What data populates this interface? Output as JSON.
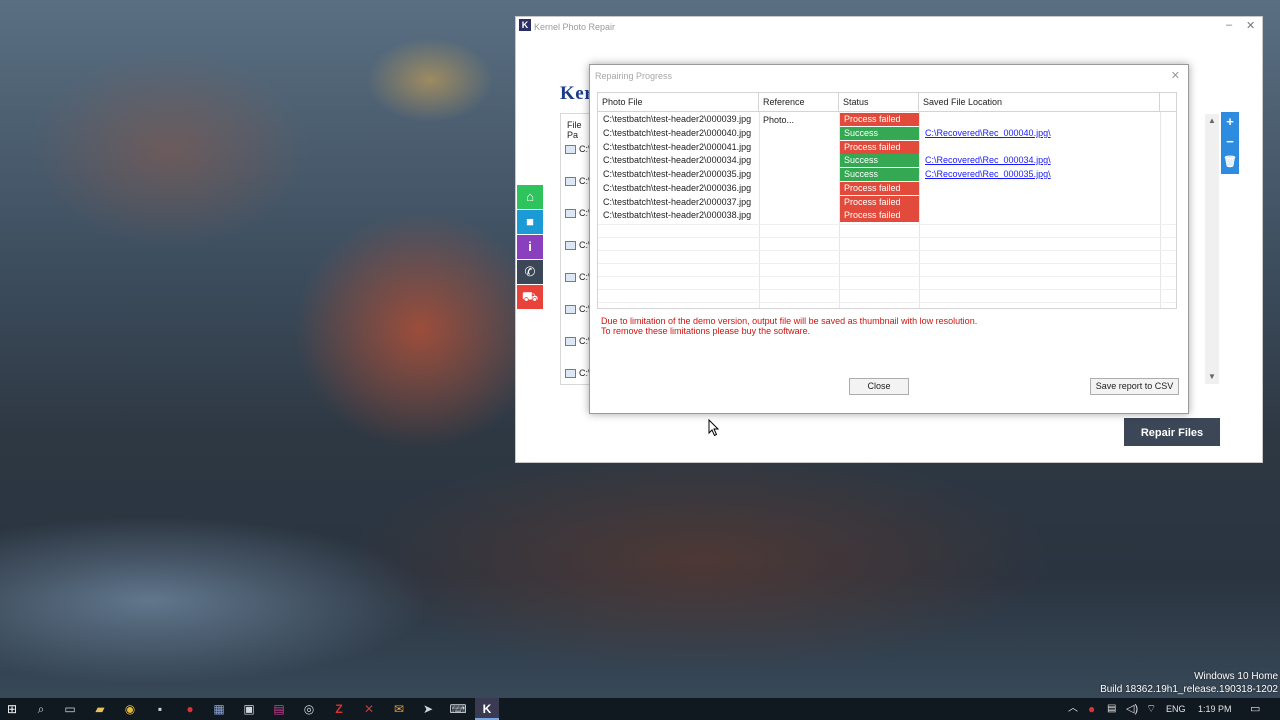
{
  "desktop": {
    "watermark_line1": "Windows 10 Home",
    "watermark_line2": "Build 18362.19h1_release.190318-1202"
  },
  "main_window": {
    "title": "Kernel Photo Repair",
    "app_icon_letter": "K",
    "minimize_glyph": "–",
    "close_glyph": "✕",
    "logo_text": "Ker",
    "list_header": "File Pa",
    "rows": [
      "C:\\",
      "C:\\",
      "C:\\",
      "C:\\",
      "C:\\",
      "C:\\",
      "C:\\",
      "C:\\"
    ],
    "side_buttons": [
      {
        "icon": "home-icon",
        "glyph": "⌂",
        "color": "#2ec35c"
      },
      {
        "icon": "video-icon",
        "glyph": "■",
        "color": "#1c9ad6"
      },
      {
        "icon": "info-icon",
        "glyph": "i",
        "color": "#8a3fbf"
      },
      {
        "icon": "phone-icon",
        "glyph": "✆",
        "color": "#3b4657"
      },
      {
        "icon": "cart-icon",
        "glyph": "⛟",
        "color": "#e8423a"
      }
    ],
    "tools": [
      {
        "icon": "add-icon",
        "glyph": "+"
      },
      {
        "icon": "remove-icon",
        "glyph": "−"
      },
      {
        "icon": "trash-icon",
        "glyph": "🗑"
      }
    ],
    "repair_button": "Repair Files"
  },
  "dialog": {
    "title": "Repairing Progress",
    "close_glyph": "✕",
    "columns": [
      "Photo File",
      "Reference Photo...",
      "Status",
      "Saved File Location"
    ],
    "rows": [
      {
        "file": "C:\\testbatch\\test-header2\\000039.jpg",
        "ref": "",
        "status": "Process failed",
        "ok": false,
        "loc": ""
      },
      {
        "file": "C:\\testbatch\\test-header2\\000040.jpg",
        "ref": "",
        "status": "Success",
        "ok": true,
        "loc": "C:\\Recovered\\Rec_000040.jpg\\"
      },
      {
        "file": "C:\\testbatch\\test-header2\\000041.jpg",
        "ref": "",
        "status": "Process failed",
        "ok": false,
        "loc": ""
      },
      {
        "file": "C:\\testbatch\\test-header2\\000034.jpg",
        "ref": "",
        "status": "Success",
        "ok": true,
        "loc": "C:\\Recovered\\Rec_000034.jpg\\"
      },
      {
        "file": "C:\\testbatch\\test-header2\\000035.jpg",
        "ref": "",
        "status": "Success",
        "ok": true,
        "loc": "C:\\Recovered\\Rec_000035.jpg\\"
      },
      {
        "file": "C:\\testbatch\\test-header2\\000036.jpg",
        "ref": "",
        "status": "Process failed",
        "ok": false,
        "loc": ""
      },
      {
        "file": "C:\\testbatch\\test-header2\\000037.jpg",
        "ref": "",
        "status": "Process failed",
        "ok": false,
        "loc": ""
      },
      {
        "file": "C:\\testbatch\\test-header2\\000038.jpg",
        "ref": "",
        "status": "Process failed",
        "ok": false,
        "loc": ""
      }
    ],
    "note_line1": "Due to limitation of the demo version, output file will be saved as thumbnail with low resolution.",
    "note_line2": "To remove these limitations please buy the software.",
    "close_button": "Close",
    "save_button": "Save report to CSV",
    "colors": {
      "fail": "#e24a3b",
      "success": "#34a853",
      "link": "#1a1aff",
      "note": "#d0140f"
    }
  },
  "taskbar": {
    "apps": [
      {
        "icon": "windows-start-icon",
        "glyph": "⊞"
      },
      {
        "icon": "search-icon",
        "glyph": "⌕"
      },
      {
        "icon": "task-view-icon",
        "glyph": "▭"
      },
      {
        "icon": "file-explorer-icon",
        "glyph": "▰"
      },
      {
        "icon": "chrome-icon",
        "glyph": "◉"
      },
      {
        "icon": "app-icon-1",
        "glyph": "▪"
      },
      {
        "icon": "record-icon",
        "glyph": "●"
      },
      {
        "icon": "app-icon-2",
        "glyph": "▦"
      },
      {
        "icon": "app-icon-3",
        "glyph": "▣"
      },
      {
        "icon": "app-icon-4",
        "glyph": "▤"
      },
      {
        "icon": "camera-icon",
        "glyph": "◎"
      },
      {
        "icon": "filezilla-icon",
        "glyph": "Z"
      },
      {
        "icon": "app-icon-5",
        "glyph": "✕"
      },
      {
        "icon": "app-icon-6",
        "glyph": "✉"
      },
      {
        "icon": "app-icon-7",
        "glyph": "➤"
      },
      {
        "icon": "app-icon-8",
        "glyph": "⌨"
      },
      {
        "icon": "kernel-icon",
        "glyph": "K"
      }
    ],
    "tray": {
      "chevron": "︿",
      "lang": "ENG",
      "time": "1:19 PM"
    }
  }
}
